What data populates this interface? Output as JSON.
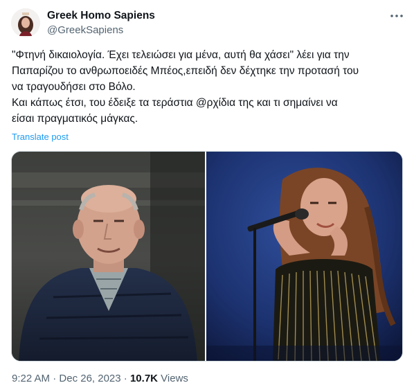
{
  "author": {
    "display_name": "Greek Homo Sapiens",
    "handle": "@GreekSapiens"
  },
  "tweet": {
    "text": "\"Φτηνή δικαιολογία. Έχει τελειώσει για μένα, αυτή θα χάσει\" λέει για την\nΠαπαρίζου το ανθρωποειδές Μπέος,επειδή δεν δέχτηκε την προτασή του\nνα τραγουδήσει στο Βόλο.\nΚαι κάπως έτσι, του έδειξε τα τεράστια @ρχίδια της και τι σημαίνει να\nείσαι πραγματικός μάγκας.",
    "translate_label": "Translate post"
  },
  "meta": {
    "time": "9:22 AM",
    "separator": " · ",
    "date": "Dec 26, 2023",
    "views_count": "10.7K",
    "views_label": " Views"
  },
  "icons": {
    "more": "more-horizontal-icon"
  },
  "colors": {
    "text": "#0f1419",
    "secondary": "#536471",
    "link": "#1d9bf0"
  }
}
